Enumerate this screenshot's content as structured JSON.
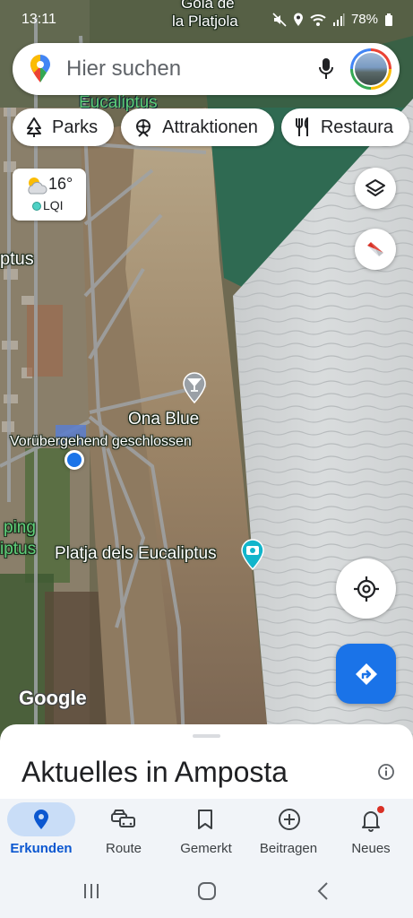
{
  "status_bar": {
    "time": "13:11",
    "battery": "78%"
  },
  "search": {
    "placeholder": "Hier suchen"
  },
  "chips": [
    {
      "label": "Parks",
      "icon": "tree-icon"
    },
    {
      "label": "Attraktionen",
      "icon": "attraction-icon"
    },
    {
      "label": "Restaura",
      "icon": "restaurant-icon"
    }
  ],
  "weather": {
    "temperature": "16°",
    "aqi_label": "LQI"
  },
  "map_labels": {
    "gola_line1": "Gola de",
    "gola_line2": "la Platjola",
    "eucaliptus_top": "Eucaliptus",
    "left_ptus": "ptus",
    "ona_blue": "Ona Blue",
    "closed": "Vorübergehend geschlossen",
    "camping_line1": "ping",
    "camping_line2": "iptus",
    "platja": "Platja dels Eucaliptus",
    "google": "Google"
  },
  "sheet": {
    "title": "Aktuelles in Amposta"
  },
  "bottom_nav": [
    {
      "label": "Erkunden",
      "icon": "explore-pin-icon",
      "active": true
    },
    {
      "label": "Route",
      "icon": "car-icon",
      "active": false
    },
    {
      "label": "Gemerkt",
      "icon": "bookmark-icon",
      "active": false
    },
    {
      "label": "Beitragen",
      "icon": "add-circle-icon",
      "active": false
    },
    {
      "label": "Neues",
      "icon": "bell-icon",
      "active": false
    }
  ],
  "colors": {
    "accent": "#1a73e8",
    "active_nav": "#0b57d0",
    "active_pill": "#c9ddf7",
    "sand": "#a08a6c",
    "sea": "#2f6a52"
  }
}
